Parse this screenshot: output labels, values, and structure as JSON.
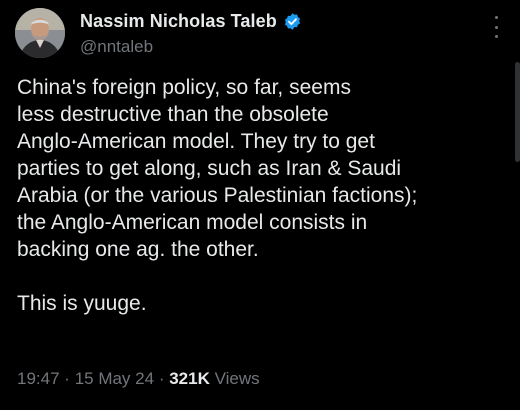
{
  "author": {
    "display_name": "Nassim Nicholas Taleb",
    "handle": "@nntaleb",
    "verified_badge_color": "#1d9bf0"
  },
  "tweet": {
    "text_lines": [
      "China's foreign policy, so far, seems",
      "less destructive than the obsolete",
      "Anglo-American model. They try to get",
      "parties to get along, such as Iran & Saudi",
      "Arabia (or the various Palestinian factions);",
      "the Anglo-American model consists in",
      "backing one ag. the other.",
      "",
      "This is yuuge."
    ],
    "time": "19:47",
    "separator": "·",
    "date": "15 May 24",
    "views_count": "321K",
    "views_label": "Views"
  },
  "icons": {
    "verified": "verified-badge-icon",
    "more": "more-options-icon"
  },
  "colors": {
    "background": "#000000",
    "primary_text": "#e7e9ea",
    "secondary_text": "#71767b",
    "accent": "#1d9bf0"
  }
}
